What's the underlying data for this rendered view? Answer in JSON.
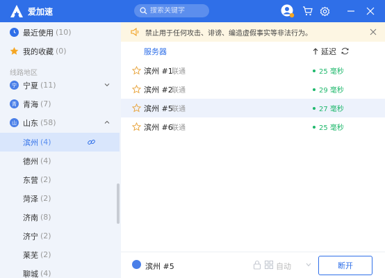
{
  "app": {
    "name": "爱加速",
    "accent": "#2f6fe8"
  },
  "search": {
    "placeholder": "搜索关键字"
  },
  "sidebar": {
    "recent": {
      "label": "最近使用",
      "count": "(10)"
    },
    "favorites": {
      "label": "我的收藏",
      "count": "(0)"
    },
    "section_title": "线路地区",
    "regions": [
      {
        "label": "宁夏",
        "count": "(11)",
        "icon": "宁"
      },
      {
        "label": "青海",
        "count": "(7)",
        "icon": "青"
      },
      {
        "label": "山东",
        "count": "(58)",
        "icon": "山"
      }
    ],
    "cities": [
      {
        "label": "滨州",
        "count": "(4)"
      },
      {
        "label": "德州",
        "count": "(4)"
      },
      {
        "label": "东营",
        "count": "(2)"
      },
      {
        "label": "菏泽",
        "count": "(2)"
      },
      {
        "label": "济南",
        "count": "(8)"
      },
      {
        "label": "济宁",
        "count": "(2)"
      },
      {
        "label": "莱芜",
        "count": "(2)"
      },
      {
        "label": "聊城",
        "count": "(4)"
      }
    ]
  },
  "notice": {
    "text": "禁止用于任何攻击、诽谤、编造虚假事实等非法行为。"
  },
  "list": {
    "header_server": "服务器",
    "header_latency": "延迟",
    "rows": [
      {
        "name": "滨州 #1",
        "isp": "联通",
        "ping": "25 毫秒"
      },
      {
        "name": "滨州 #2",
        "isp": "联通",
        "ping": "29 毫秒"
      },
      {
        "name": "滨州 #5",
        "isp": "联通",
        "ping": "27 毫秒"
      },
      {
        "name": "滨州 #6",
        "isp": "联通",
        "ping": "25 毫秒"
      }
    ]
  },
  "bottom": {
    "current_server": "滨州 #5",
    "mode": "自动",
    "disconnect_label": "断开"
  }
}
